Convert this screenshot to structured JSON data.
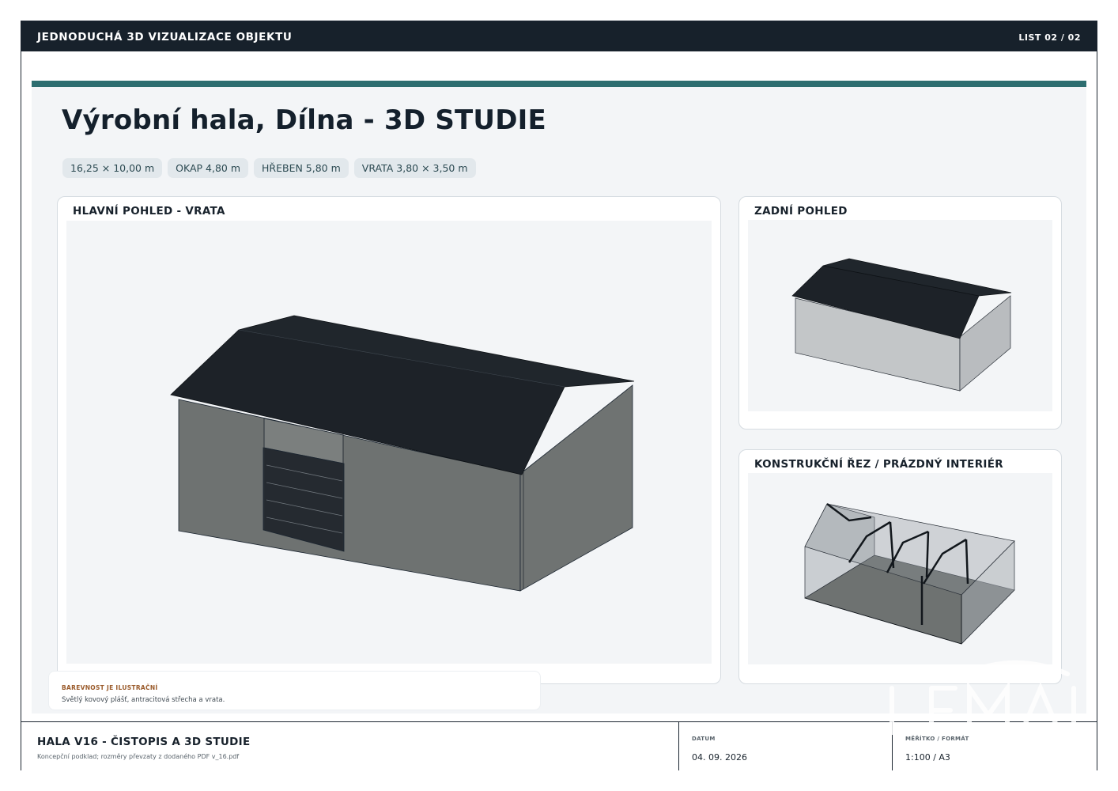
{
  "header": {
    "title": "JEDNODUCHÁ 3D VIZUALIZACE OBJEKTU",
    "sheet": "LIST 02 / 02"
  },
  "main": {
    "heading": "Výrobní hala, Dílna - 3D STUDIE",
    "chips": [
      "16,25 × 10,00 m",
      "OKAP 4,80 m",
      "HŘEBEN 5,80 m",
      "VRATA 3,80 × 3,50 m"
    ]
  },
  "panels": {
    "main_view": {
      "title": "HLAVNÍ POHLED - VRATA"
    },
    "rear_view": {
      "title": "ZADNÍ POHLED"
    },
    "section_view": {
      "title": "KONSTRUKČNÍ ŘEZ / PRÁZDNÝ INTERIÉR"
    }
  },
  "note": {
    "title": "BAREVNOST JE ILUSTRAČNÍ",
    "body": "Světlý kovový plášť, antracitová střecha a vrata."
  },
  "footer": {
    "title": "HALA V16 - ČISTOPIS A 3D STUDIE",
    "subtitle": "Koncepční podklad; rozměry převzaty z dodaného PDF v_16.pdf",
    "date_label": "DATUM",
    "date_value": "04. 09. 2026",
    "scale_label": "MĚŘÍTKO / FORMÁT",
    "scale_value": "1:100 / A3"
  },
  "colors": {
    "header_bg": "#17212b",
    "accent_teal": "#2d6e70",
    "roof": "#1d2228",
    "wall_main": "#6e7271",
    "wall_light": "#c3c6c8",
    "note_title": "#9a5a2a"
  },
  "icons": {
    "watermark": "company-logo-watermark"
  }
}
